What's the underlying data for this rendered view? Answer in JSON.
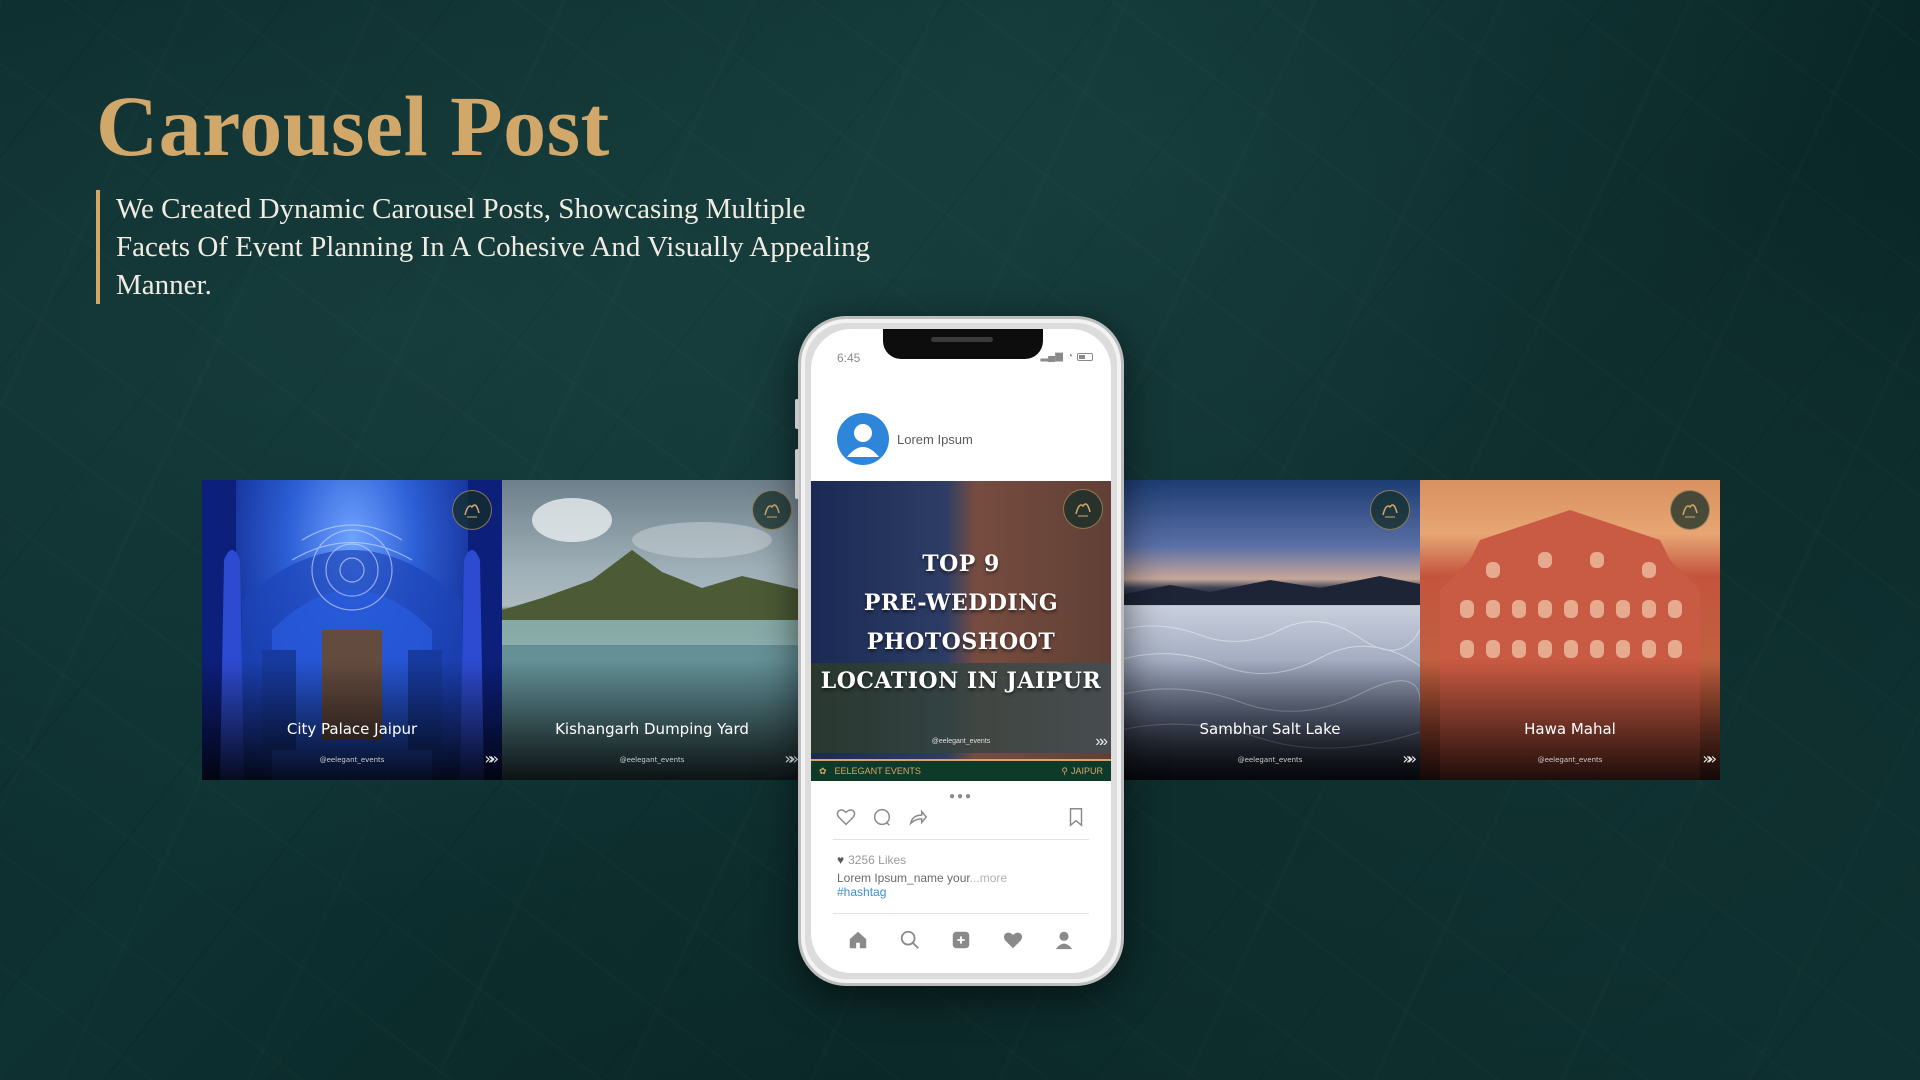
{
  "heading": {
    "title": "Carousel Post",
    "description": "We Created Dynamic Carousel Posts, Showcasing Multiple Facets Of Event Planning In A Cohesive And Visually Appealing Manner."
  },
  "cards": [
    {
      "caption": "City Palace Jaipur",
      "handle": "@eelegant_events"
    },
    {
      "caption": "Kishangarh Dumping Yard",
      "handle": "@eelegant_events"
    },
    {
      "caption": "Sambhar Salt Lake",
      "handle": "@eelegant_events"
    },
    {
      "caption": "Hawa Mahal",
      "handle": "@eelegant_events"
    }
  ],
  "phone": {
    "time": "6:45",
    "profile_name": "Lorem Ipsum",
    "post": {
      "title_lines": [
        "TOP 9",
        "PRE-WEDDING",
        "PHOTOSHOOT",
        "LOCATION IN JAIPUR"
      ],
      "handle": "@eelegant_events",
      "brand": "EELEGANT EVENTS",
      "location": "JAIPUR"
    },
    "likes": "3256 Likes",
    "caption": "Lorem Ipsum_name your",
    "more": "...more",
    "hashtag": "#hashtag"
  },
  "colors": {
    "accent": "#d2a76a",
    "background": "#0d2e2e",
    "avatar": "#2d86d9",
    "hashtag": "#3a8fd1"
  }
}
